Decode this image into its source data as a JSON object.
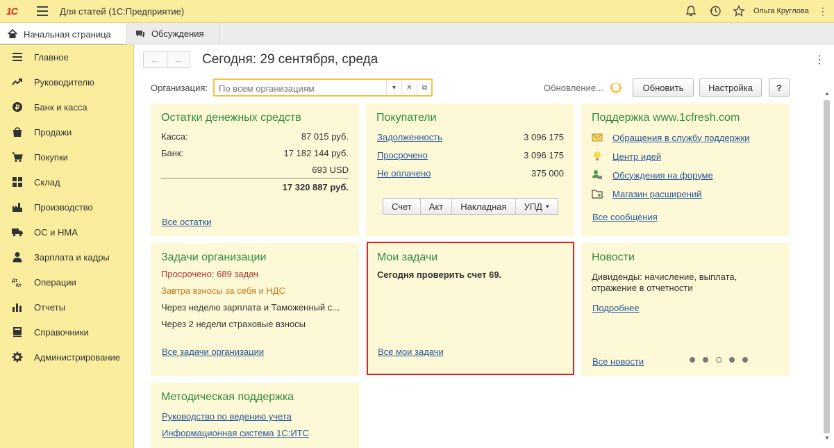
{
  "titlebar": {
    "logo": "1С",
    "app_title": "Для статей  (1С:Предприятие)",
    "user_name": "Ольга Круглова"
  },
  "tabs": [
    {
      "label": "Начальная страница",
      "icon": "home-icon"
    },
    {
      "label": "Обсуждения",
      "icon": "chat-icon"
    }
  ],
  "sidebar": {
    "items": [
      {
        "label": "Главное",
        "icon": "menu-lines-icon"
      },
      {
        "label": "Руководителю",
        "icon": "trend-icon"
      },
      {
        "label": "Банк и касса",
        "icon": "coin-icon"
      },
      {
        "label": "Продажи",
        "icon": "bag-icon"
      },
      {
        "label": "Покупки",
        "icon": "cart-icon"
      },
      {
        "label": "Склад",
        "icon": "warehouse-icon"
      },
      {
        "label": "Производство",
        "icon": "factory-icon"
      },
      {
        "label": "ОС и НМА",
        "icon": "truck-icon"
      },
      {
        "label": "Зарплата и кадры",
        "icon": "person-icon"
      },
      {
        "label": "Операции",
        "icon": "dt-kt-icon"
      },
      {
        "label": "Отчеты",
        "icon": "bar-chart-icon"
      },
      {
        "label": "Справочники",
        "icon": "book-icon"
      },
      {
        "label": "Администрирование",
        "icon": "gear-icon"
      }
    ]
  },
  "main": {
    "title": "Сегодня: 29 сентября, среда",
    "org_label": "Организация:",
    "org_placeholder": "По всем организациям",
    "update_label": "Обновление...",
    "refresh_button": "Обновить",
    "settings_button": "Настройка",
    "help_button": "?"
  },
  "cash": {
    "title": "Остатки денежных средств",
    "kassa_label": "Касса:",
    "kassa_value": "87 015 руб.",
    "bank_label": "Банк:",
    "bank_value": "17 182 144 руб.",
    "usd_value": "693 USD",
    "total_value": "17 320 887 руб.",
    "all_link": "Все остатки"
  },
  "buyers": {
    "title": "Покупатели",
    "rows": [
      {
        "label": "Задолженность",
        "value": "3 096 175"
      },
      {
        "label": "Просрочено",
        "value": "3 096 175"
      },
      {
        "label": "Не оплачено",
        "value": "375 000"
      }
    ],
    "buttons": [
      "Счет",
      "Акт",
      "Накладная",
      "УПД"
    ]
  },
  "support": {
    "title": "Поддержка www.1cfresh.com",
    "links": [
      {
        "label": "Обращения в службу поддержки",
        "icon": "envelope-icon"
      },
      {
        "label": "Центр идей",
        "icon": "lightbulb-icon"
      },
      {
        "label": "Обсуждения на форуме",
        "icon": "forum-icon"
      },
      {
        "label": "Магазин расширений",
        "icon": "folder-plus-icon"
      }
    ],
    "all_link": "Все сообщения"
  },
  "org_tasks": {
    "title": "Задачи организации",
    "overdue": "Просрочено: 689 задач",
    "tomorrow": "Завтра взносы за себя и НДС",
    "week": "Через неделю зарплата и Таможенный с...",
    "two_weeks": "Через 2 недели страховые взносы",
    "all_link": "Все задачи организации"
  },
  "my_tasks": {
    "title": "Мои задачи",
    "task": "Сегодня проверить счет 69.",
    "all_link": "Все мои задачи"
  },
  "news": {
    "title": "Новости",
    "text": "Дивиденды: начисление, выплата, отражение в отчетности",
    "more_link": "Подробнее",
    "all_link": "Все новости"
  },
  "method": {
    "title": "Методическая поддержка",
    "link1": "Руководство по ведению учета",
    "link2": "Информационная система 1С:ИТС"
  },
  "colors": {
    "accent_green": "#2e8b41",
    "link_blue": "#26569b",
    "highlight_red": "#e02020",
    "overdue_red": "#c0392b",
    "warning_orange": "#c9781e",
    "panel_bg": "#fdf8d6",
    "sidebar_bg": "#fbed9e"
  }
}
